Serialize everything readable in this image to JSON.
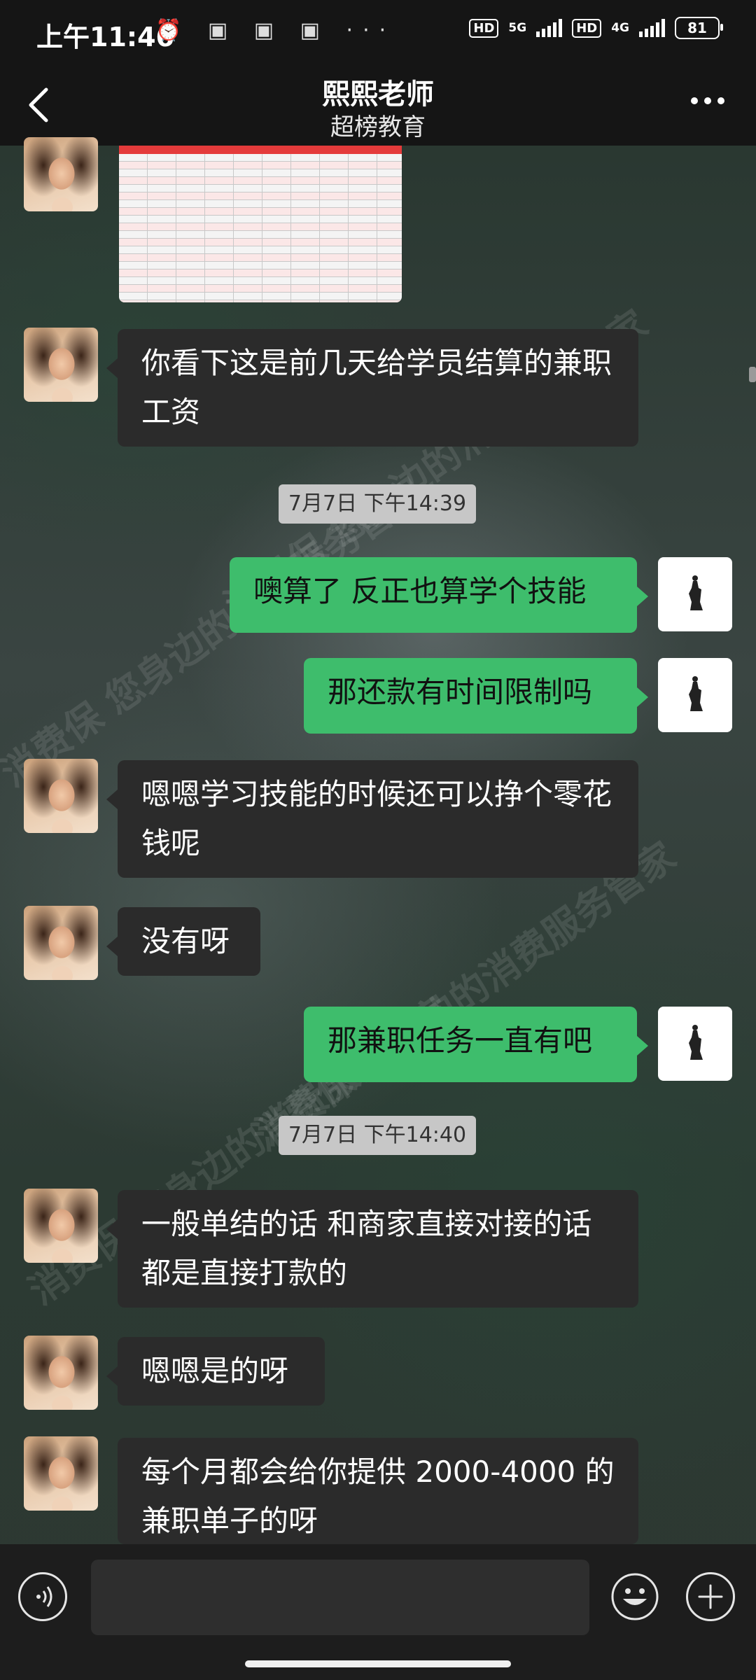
{
  "status": {
    "time": "上午11:46",
    "network_5g": "5G",
    "network_4g": "4G",
    "hd": "HD",
    "battery": "81",
    "more_dots": "···"
  },
  "header": {
    "title": "熙熙老师",
    "subtitle": "超榜教育"
  },
  "watermark": {
    "texts": [
      "消费保 您身边的消费服务管家",
      "消费保 您身边的消费服务管家",
      "消费保 您身边的消费服务管家",
      "消费保 您身边的消费服务管家"
    ]
  },
  "messages": {
    "m1": "你看下这是前几天给学员结算的兼职工资",
    "ts1": "7月7日 下午14:39",
    "m2": "噢算了 反正也算学个技能",
    "m3": "那还款有时间限制吗",
    "m4": "嗯嗯学习技能的时候还可以挣个零花钱呢",
    "m5": "没有呀",
    "m6": "那兼职任务一直有吧",
    "ts2": "7月7日 下午14:40",
    "m7": "一般单结的话  和商家直接对接的话 都是直接打款的",
    "m8": "嗯嗯是的呀",
    "m9": "每个月都会给你提供 2000-4000 的兼职单子的呀"
  },
  "input": {
    "placeholder": ""
  },
  "colors": {
    "sent_bubble": "#3ebd6c",
    "received_bubble": "#2b2b2b",
    "bar_bg": "#151515"
  }
}
